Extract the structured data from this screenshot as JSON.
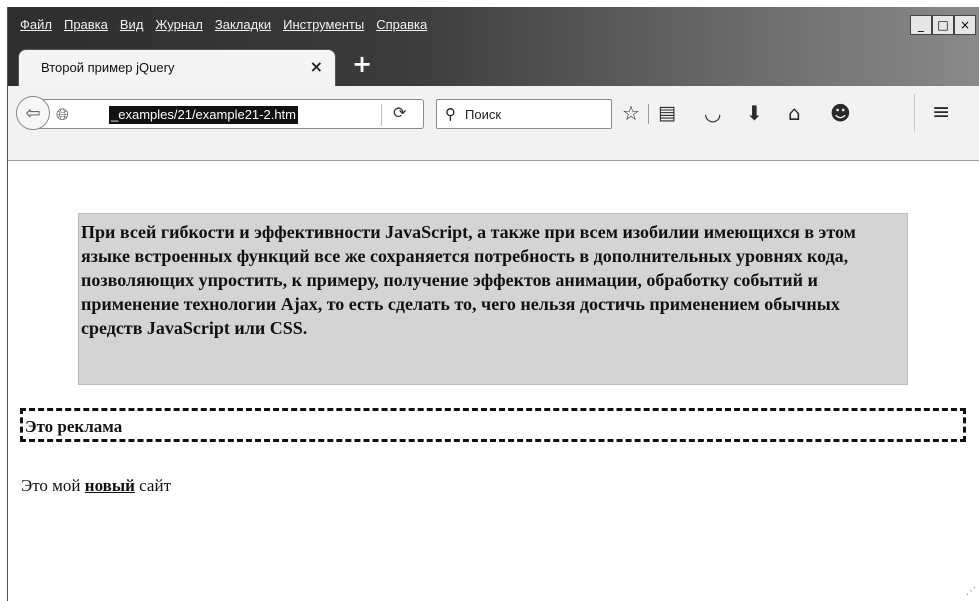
{
  "menu": [
    "Файл",
    "Правка",
    "Вид",
    "Журнал",
    "Закладки",
    "Инструменты",
    "Справка"
  ],
  "window_buttons": {
    "minimize": "_",
    "maximize": "□",
    "close": "×"
  },
  "tab": {
    "title": "Второй пример jQuery",
    "close": "×",
    "new_tab": "+"
  },
  "toolbar": {
    "url": "_examples/21/example21-2.htm",
    "search_placeholder": "Поиск",
    "icons": [
      "back-icon",
      "globe-icon",
      "reload-icon",
      "search-icon",
      "bookmark-star-icon",
      "reading-list-icon",
      "pocket-icon",
      "download-icon",
      "home-icon",
      "chat-icon",
      "menu-icon"
    ]
  },
  "content": {
    "paragraph": "При всей гибкости и эффективности JavaScript, а также при всем изобилии имеющихся в этом языке встроенных функций все же сохраняется потребность в дополнительных уровнях кода, позволяющих упростить, к примеру, получение эффектов анимации, обработку событий и применение технологии Ajax, то есть сделать то, чего нельзя достичь применением обычных средств JavaScript или CSS.",
    "ad": "Это реклама",
    "site_prefix": "Это мой",
    "site_bold": "новый",
    "site_suffix": "сайт"
  }
}
